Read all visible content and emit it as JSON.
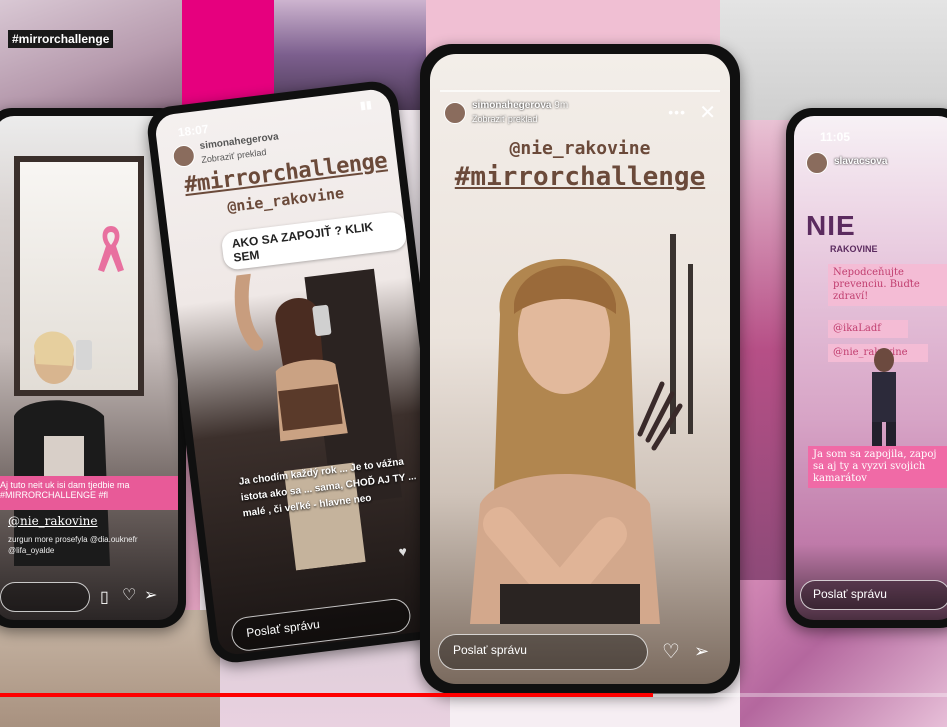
{
  "collage": {
    "top_left_tag": "#mirrorchallenge"
  },
  "phone_left": {
    "banner": "Aj tuto neit uk isi dam tjedbie ma #MIRRORCHALLENGE #fl",
    "handle": "@nie_rakovine",
    "small_text": "zurgun more prosefyla @dia.ouknefr @lifa_oyalde",
    "heart_icon": "heart-icon",
    "send_icon": "send-icon"
  },
  "phone_tilted": {
    "time": "18:07",
    "user": "simonahegerova",
    "sub": "Zobraziť preklad",
    "hashtag": "#mirrorchallenge",
    "handle": "@nie_rakovine",
    "sticker": "AKO SA ZAPOJIŤ ? KLIK SEM",
    "caption": "Ja chodím každý rok ... Je to vážna istota ako sa ... sama, CHOĎ AJ TY ... malé , či veľké - hlavne neo",
    "message_placeholder": "Poslať správu"
  },
  "phone_center": {
    "user": "simonahegerova",
    "time_ago": "9m",
    "sub": "Zobraziť preklad",
    "handle": "@nie_rakovine",
    "hashtag": "#mirrorchallenge",
    "message_placeholder": "Poslať správu"
  },
  "phone_right": {
    "time": "11:05",
    "user": "slavacsova",
    "logo": "NIE",
    "logo_sub": "RAKOVINE",
    "box1": "Nepodceňujte prevenciu. Buďte zdraví!",
    "box2": "@ikaLadf",
    "box3": "@nie_rakovine",
    "box4": "Ja som sa zapojila, zapoj sa aj ty a vyzvi svojich kamarátov",
    "message_placeholder": "Poslať správu"
  },
  "video": {
    "progress": 0.69,
    "progress_color": "#ff0000"
  }
}
